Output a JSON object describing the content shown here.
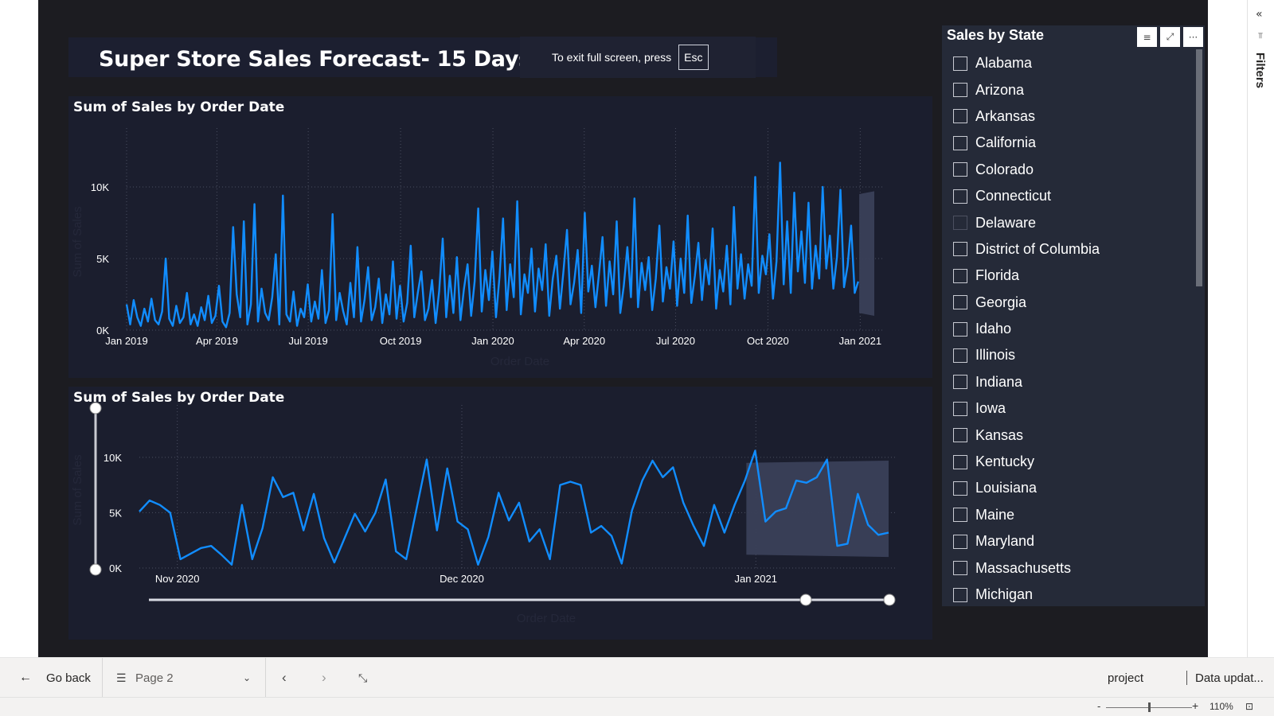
{
  "report": {
    "title": "Super Store Sales Forecast- 15 Days Forecast"
  },
  "toast": {
    "text": "To exit full screen, press",
    "key": "Esc"
  },
  "colors": {
    "canvas": "#1c1c21",
    "panel": "#1b1e2e",
    "line": "#118dff",
    "forecast_band": "#3a4058",
    "forecast_band_top": "#5a4a50"
  },
  "chart_data": [
    {
      "type": "line",
      "title": "Sum of Sales by Order Date",
      "xlabel": "Order Date",
      "ylabel": "Sum of Sales",
      "ylim": [
        0,
        12000
      ],
      "yticks": [
        "0K",
        "5K",
        "10K"
      ],
      "x_ticks": [
        "Jan 2019",
        "Apr 2019",
        "Jul 2019",
        "Oct 2019",
        "Jan 2020",
        "Apr 2020",
        "Jul 2020",
        "Oct 2020",
        "Jan 2021"
      ],
      "x_range": [
        "2019-01-01",
        "2020-12-30"
      ],
      "forecast": {
        "from": "2020-12-31",
        "to": "2021-01-15",
        "upper": 9500,
        "lower": 1200
      },
      "series": [
        {
          "values": [
            1800,
            400,
            2100,
            900,
            300,
            1500,
            600,
            2200,
            700,
            400,
            1300,
            5000,
            800,
            300,
            1700,
            500,
            900,
            2600,
            400,
            1100,
            300,
            1600,
            700,
            2400,
            500,
            1000,
            3100,
            600,
            200,
            1200,
            7200,
            2500,
            900,
            7600,
            400,
            1800,
            8800,
            600,
            2900,
            1200,
            700,
            2300,
            5300,
            400,
            9400,
            1100,
            600,
            2700,
            300,
            1500,
            900,
            3200,
            600,
            2000,
            800,
            4200,
            500,
            1400,
            8100,
            700,
            2600,
            1300,
            400,
            3300,
            900,
            5800,
            600,
            2100,
            4400,
            700,
            1600,
            3600,
            500,
            2500,
            1100,
            4800,
            800,
            3100,
            600,
            1900,
            5900,
            900,
            2600,
            4100,
            700,
            1500,
            3500,
            500,
            2700,
            6400,
            900,
            3800,
            1200,
            5100,
            700,
            2900,
            4600,
            1000,
            3400,
            8500,
            1300,
            4200,
            2100,
            5500,
            900,
            3700,
            7800,
            1400,
            4600,
            2300,
            9000,
            1100,
            3900,
            2600,
            5700,
            1300,
            4300,
            2800,
            6000,
            1000,
            3600,
            5200,
            1500,
            4100,
            7000,
            1800,
            3300,
            5600,
            1200,
            8200,
            2700,
            4500,
            1600,
            3900,
            6500,
            1700,
            4800,
            2500,
            7600,
            1200,
            3100,
            5800,
            2300,
            9200,
            1600,
            4700,
            2800,
            5100,
            1400,
            3600,
            7300,
            2000,
            4400,
            2900,
            6200,
            1700,
            5000,
            2600,
            8000,
            1900,
            3800,
            6100,
            2100,
            4900,
            3200,
            7100,
            1500,
            4200,
            2700,
            5900,
            1800,
            8600,
            2900,
            5300,
            2200,
            4600,
            3100,
            10700,
            2600,
            5200,
            3900,
            6700,
            2200,
            4800,
            11700,
            3200,
            7600,
            2600,
            9600,
            4100,
            6900,
            3300,
            8900,
            2900,
            5900,
            3600,
            10000,
            4300,
            6600,
            2900,
            5100,
            9800,
            3000,
            4500,
            7300,
            2600,
            3400
          ]
        }
      ]
    },
    {
      "type": "line",
      "title": "Sum of Sales by Order Date",
      "xlabel": "Order Date",
      "ylabel": "Sum of Sales",
      "ylim": [
        0,
        12000
      ],
      "yticks": [
        "0K",
        "5K",
        "10K"
      ],
      "x_ticks": [
        "Nov 2020",
        "Dec 2020",
        "Jan 2021"
      ],
      "x_range": [
        "2020-10-28",
        "2021-01-15"
      ],
      "forecast": {
        "from": "2020-12-31",
        "to": "2021-01-15",
        "upper": 9500,
        "lower": 1200
      },
      "series": [
        {
          "x_start": "2020-10-28",
          "values": [
            5100,
            6100,
            5700,
            5000,
            800,
            1300,
            1800,
            2000,
            1200,
            300,
            5700,
            800,
            3600,
            8200,
            6400,
            6800,
            3400,
            6700,
            2700,
            500,
            2700,
            4900,
            3300,
            5000,
            8000,
            1500,
            800,
            5300,
            9800,
            3400,
            9000,
            4200,
            3500,
            300,
            2800,
            6800,
            4300,
            5900,
            2400,
            3500,
            800,
            7500,
            7800,
            7500,
            3200,
            3800,
            2900,
            400,
            5200,
            7900,
            9700,
            8200,
            9100,
            5900,
            3800,
            2000,
            5700,
            3200,
            5700,
            7900,
            10600,
            4200,
            5100,
            5400,
            7900,
            7700,
            8200,
            9800,
            2000,
            2200,
            6700,
            3900,
            3000,
            3200
          ]
        }
      ],
      "range_slider": {
        "start": "2020-10-28",
        "end": "2021-01-15"
      }
    }
  ],
  "slicer": {
    "title": "Sales by State",
    "icons": [
      "filter-icon",
      "focus-mode-icon",
      "more-options-icon"
    ],
    "items": [
      "Alabama",
      "Arizona",
      "Arkansas",
      "California",
      "Colorado",
      "Connecticut",
      "Delaware",
      "District of Columbia",
      "Florida",
      "Georgia",
      "Idaho",
      "Illinois",
      "Indiana",
      "Iowa",
      "Kansas",
      "Kentucky",
      "Louisiana",
      "Maine",
      "Maryland",
      "Massachusetts",
      "Michigan"
    ]
  },
  "filters_pane": {
    "label": "Filters"
  },
  "bottom_bar": {
    "go_back": "Go back",
    "page": "Page 2",
    "workspace": "project",
    "data_updated": "Data updat..."
  },
  "status_bar": {
    "zoom_minus": "-",
    "zoom_plus": "+",
    "zoom_level": "110%",
    "zoom_fraction": 0.5
  }
}
